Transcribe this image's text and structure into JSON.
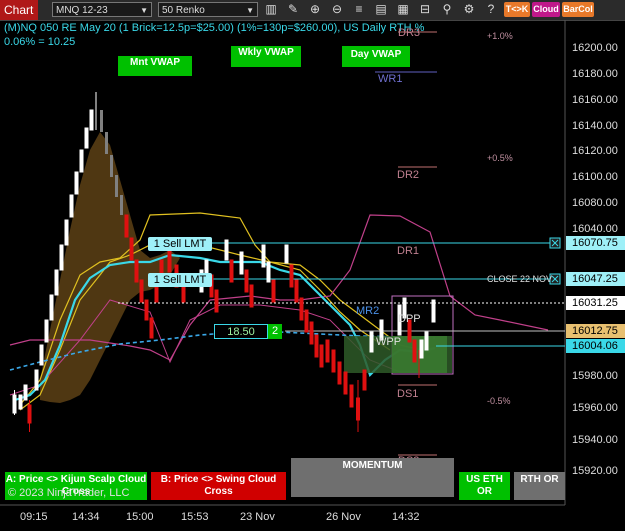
{
  "toolbar": {
    "title": "Chart",
    "instrument": "MNQ 12-23",
    "bar_type": "50 Renko",
    "buttons": [
      {
        "label": "T<>K",
        "color": "#e8792a"
      },
      {
        "label": "Cloud",
        "color": "#c0188a"
      },
      {
        "label": "BarCol",
        "color": "#e8792a"
      }
    ],
    "icons": [
      "bar-style-icon",
      "draw-tool-icon",
      "drawing-icon",
      "zoom-in-icon",
      "zoom-out-icon",
      "properties-icon",
      "chart-trader-icon",
      "attach-icon",
      "data-box-icon",
      "link-icon",
      "help-icon"
    ]
  },
  "header": {
    "title": "(M)NQ 050 RE May 20 (1 Brick=12.5p=$25.00) (1%=130p=$260.00), US Daily RTH %",
    "subtitle": "0.06% = 10.25"
  },
  "vwap_labels": [
    {
      "label": "Mnt VWAP",
      "color": "#00c000"
    },
    {
      "label": "Wkly VWAP",
      "color": "#00c000"
    },
    {
      "label": "Day VWAP",
      "color": "#00c000"
    }
  ],
  "pivot_labels": {
    "dr3": "DR3",
    "wr1": "WR1",
    "dr2": "DR2",
    "dr1": "DR1",
    "mr2": "MR2",
    "dpp": "DPP",
    "wpp": "WPP",
    "ds1": "DS1",
    "ds2": "DS2"
  },
  "percent_labels": {
    "p1": "+1.0%",
    "p05": "+0.5%",
    "m05": "-0.5%"
  },
  "orders": [
    {
      "label": "1 Sell LMT",
      "price": "16070.75"
    },
    {
      "label": "1 Sell LMT",
      "price": "16047.25"
    }
  ],
  "close_label": "CLOSE 22 NOV",
  "position_box": {
    "value": "18.50",
    "count": "2"
  },
  "price_axis": {
    "ticks": [
      "16200.00",
      "16180.00",
      "16160.00",
      "16140.00",
      "16120.00",
      "16100.00",
      "16080.00",
      "16040.00",
      "16020.00",
      "16000.00",
      "15980.00",
      "15960.00",
      "15940.00",
      "15920.00"
    ],
    "tags": [
      {
        "value": "16070.75",
        "bg": "#9ef0f8",
        "fg": "#000"
      },
      {
        "value": "16047.25",
        "bg": "#9ef0f8",
        "fg": "#000"
      },
      {
        "value": "16031.25",
        "bg": "#ffffff",
        "fg": "#000"
      },
      {
        "value": "16012.75",
        "bg": "#e8c070",
        "fg": "#000"
      },
      {
        "value": "16004.06",
        "bg": "#3ad8e8",
        "fg": "#000"
      }
    ],
    "partial_top": "16040.00"
  },
  "time_axis": [
    "09:15",
    "14:34",
    "15:00",
    "15:53",
    "23 Nov",
    "26 Nov",
    "14:32"
  ],
  "bottom_boxes": [
    {
      "label": "A: Price <> Kijun Scalp Cloud Cross",
      "color": "#00c000"
    },
    {
      "label": "B: Price <> Swing Cloud Cross",
      "color": "#d00000"
    },
    {
      "label": "MOMENTUM",
      "color": "#6f6f6f"
    },
    {
      "label": "US ETH OR",
      "color": "#00c000"
    },
    {
      "label": "RTH OR",
      "color": "#6f6f6f"
    }
  ],
  "copyright": "© 2023 NinjaTrader, LLC",
  "colors": {
    "up": "#ffffff",
    "down": "#e01010",
    "cyan": "#3ad8e8",
    "kumo": "#e0c020",
    "pink": "#c0408a"
  }
}
